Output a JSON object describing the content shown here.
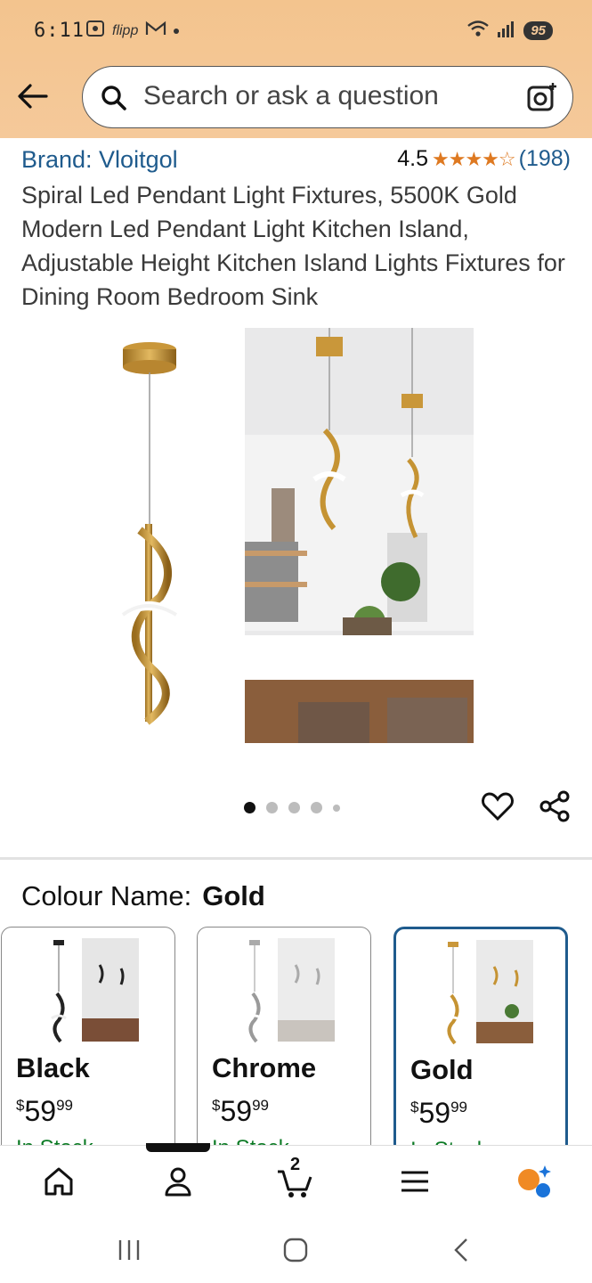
{
  "status_bar": {
    "time": "6:11",
    "icons_left": [
      "screenshot-icon",
      "flipp-icon",
      "gmail-icon",
      "dot-icon"
    ],
    "icons_left_text": [
      "flipp"
    ],
    "battery": "95"
  },
  "header": {
    "search_placeholder": "Search or ask a question"
  },
  "product": {
    "brand": "Brand: Vloitgol",
    "rating_value": "4.5",
    "rating_stars": "★★★★☆",
    "rating_count": "(198)",
    "title": "Spiral Led Pendant Light Fixtures, 5500K Gold Modern Led Pendant Light Kitchen Island, Adjustable Height Kitchen Island Lights Fixtures for Dining Room Bedroom Sink",
    "image_pager": {
      "total": 5,
      "active": 1
    }
  },
  "colour": {
    "label": "Colour Name:",
    "selected": "Gold",
    "options": [
      {
        "name": "Black",
        "currency": "$",
        "price_whole": "59",
        "price_fraction": "99",
        "stock": "In Stock"
      },
      {
        "name": "Chrome",
        "currency": "$",
        "price_whole": "59",
        "price_fraction": "99",
        "stock": "In Stock"
      },
      {
        "name": "Gold",
        "currency": "$",
        "price_whole": "59",
        "price_fraction": "99",
        "stock": "In Stock"
      }
    ]
  },
  "bottom_nav": {
    "items": [
      "home-icon",
      "account-icon",
      "cart-icon",
      "menu-icon",
      "rufus-icon"
    ],
    "cart_count": "2"
  },
  "colors": {
    "header_bg": "#f5c99a",
    "link": "#1f5b8d",
    "star": "#de7921",
    "stock_green": "#0b7a24"
  }
}
